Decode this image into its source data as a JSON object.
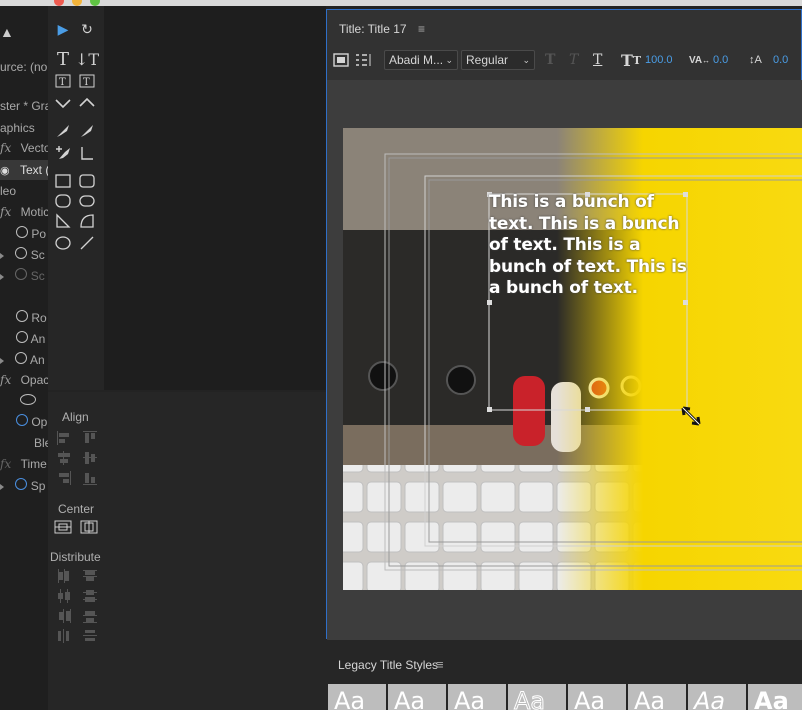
{
  "left_panel": {
    "items": [
      {
        "text": "urce: (no c"
      },
      {
        "text": "ster * Grap"
      },
      {
        "text": "aphics"
      },
      {
        "text": "Vecto"
      },
      {
        "text": "Text ("
      },
      {
        "text": "leo"
      },
      {
        "text": "Motic"
      },
      {
        "text": "Po"
      },
      {
        "text": "Sc"
      },
      {
        "text": "Sc"
      },
      {
        "text": "Ro"
      },
      {
        "text": "An"
      },
      {
        "text": "An"
      },
      {
        "text": "Opaci"
      },
      {
        "text": "Op"
      },
      {
        "text": "Ble"
      },
      {
        "text": "Time"
      },
      {
        "text": "Sp"
      }
    ],
    "fx_label": "fx"
  },
  "align_panel": {
    "align_label": "Align",
    "center_label": "Center",
    "distribute_label": "Distribute"
  },
  "title_panel": {
    "title": "Title: Title 17",
    "font_family": "Abadi M...",
    "font_style": "Regular",
    "font_size": "100.0",
    "kerning": "0.0",
    "leading": "0.0",
    "text_content": "This is a bunch of text. This is a bunch of text. This is a bunch of text. This is a bunch of text."
  },
  "legacy_styles": {
    "label": "Legacy Title Styles",
    "swatches": [
      "Aa",
      "Aa",
      "Aa",
      "Aa",
      "Aa",
      "Aa",
      "Aa",
      "Aa"
    ]
  },
  "colors": {
    "accent_blue": "#4a9de6",
    "panel_border": "#2f6fc8",
    "yellow": "#f6d500"
  }
}
